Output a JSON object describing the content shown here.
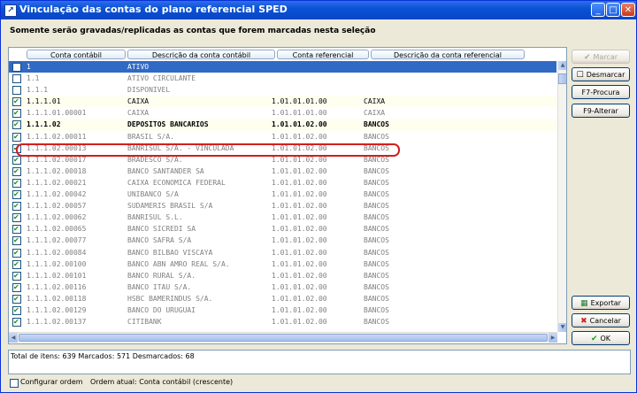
{
  "window": {
    "title": "Vinculação das contas do plano referencial SPED",
    "minimize": "_",
    "maximize": "□",
    "close": "✕"
  },
  "subtitle": "Somente serão gravadas/replicadas as contas que forem marcadas nesta seleção",
  "columns": [
    "Conta contábil",
    "Descrição da conta contábil",
    "Conta referencial",
    "Descrição da conta referencial"
  ],
  "rows": [
    {
      "checked": false,
      "style": "sel",
      "conta": "1",
      "descricao": "ATIVO",
      "ref": "",
      "ref_desc": ""
    },
    {
      "checked": false,
      "style": "",
      "conta": "1.1",
      "descricao": "ATIVO CIRCULANTE",
      "ref": "",
      "ref_desc": ""
    },
    {
      "checked": false,
      "style": "",
      "conta": "1.1.1",
      "descricao": "DISPONIVEL",
      "ref": "",
      "ref_desc": ""
    },
    {
      "checked": true,
      "style": "hl",
      "conta": "1.1.1.01",
      "descricao": "CAIXA",
      "ref": "1.01.01.01.00",
      "ref_desc": "CAIXA"
    },
    {
      "checked": true,
      "style": "",
      "conta": "1.1.1.01.00001",
      "descricao": "CAIXA",
      "ref": "1.01.01.01.00",
      "ref_desc": "CAIXA"
    },
    {
      "checked": true,
      "style": "syn",
      "conta": "1.1.1.02",
      "descricao": "DEPOSITOS BANCARIOS",
      "ref": "1.01.01.02.00",
      "ref_desc": "BANCOS"
    },
    {
      "checked": true,
      "style": "",
      "conta": "1.1.1.02.00011",
      "descricao": "BRASIL S/A.",
      "ref": "1.01.01.02.00",
      "ref_desc": "BANCOS"
    },
    {
      "checked": true,
      "style": "",
      "conta": "1.1.1.02.00013",
      "descricao": "BANRISUL S/A. - VINCULADA",
      "ref": "1.01.01.02.00",
      "ref_desc": "BANCOS"
    },
    {
      "checked": true,
      "style": "",
      "conta": "1.1.1.02.00017",
      "descricao": "BRADESCO S/A.",
      "ref": "1.01.01.02.00",
      "ref_desc": "BANCOS"
    },
    {
      "checked": true,
      "style": "",
      "conta": "1.1.1.02.00018",
      "descricao": "BANCO SANTANDER SA",
      "ref": "1.01.01.02.00",
      "ref_desc": "BANCOS"
    },
    {
      "checked": true,
      "style": "",
      "conta": "1.1.1.02.00021",
      "descricao": "CAIXA ECONOMICA FEDERAL",
      "ref": "1.01.01.02.00",
      "ref_desc": "BANCOS"
    },
    {
      "checked": true,
      "style": "",
      "conta": "1.1.1.02.00042",
      "descricao": "UNIBANCO S/A",
      "ref": "1.01.01.02.00",
      "ref_desc": "BANCOS"
    },
    {
      "checked": true,
      "style": "",
      "conta": "1.1.1.02.00057",
      "descricao": "SUDAMERIS BRASIL S/A",
      "ref": "1.01.01.02.00",
      "ref_desc": "BANCOS"
    },
    {
      "checked": true,
      "style": "",
      "conta": "1.1.1.02.00062",
      "descricao": "BANRISUL S.L.",
      "ref": "1.01.01.02.00",
      "ref_desc": "BANCOS"
    },
    {
      "checked": true,
      "style": "",
      "conta": "1.1.1.02.00065",
      "descricao": "BANCO SICREDI SA",
      "ref": "1.01.01.02.00",
      "ref_desc": "BANCOS"
    },
    {
      "checked": true,
      "style": "",
      "conta": "1.1.1.02.00077",
      "descricao": "BANCO SAFRA S/A",
      "ref": "1.01.01.02.00",
      "ref_desc": "BANCOS"
    },
    {
      "checked": true,
      "style": "",
      "conta": "1.1.1.02.00084",
      "descricao": "BANCO BILBAO VISCAYA",
      "ref": "1.01.01.02.00",
      "ref_desc": "BANCOS"
    },
    {
      "checked": true,
      "style": "",
      "conta": "1.1.1.02.00100",
      "descricao": "BANCO ABN AMRO REAL S/A.",
      "ref": "1.01.01.02.00",
      "ref_desc": "BANCOS"
    },
    {
      "checked": true,
      "style": "",
      "conta": "1.1.1.02.00101",
      "descricao": "BANCO RURAL S/A.",
      "ref": "1.01.01.02.00",
      "ref_desc": "BANCOS"
    },
    {
      "checked": true,
      "style": "",
      "conta": "1.1.1.02.00116",
      "descricao": "BANCO ITAU S/A.",
      "ref": "1.01.01.02.00",
      "ref_desc": "BANCOS"
    },
    {
      "checked": true,
      "style": "",
      "conta": "1.1.1.02.00118",
      "descricao": "HSBC BAMERINDUS S/A.",
      "ref": "1.01.01.02.00",
      "ref_desc": "BANCOS"
    },
    {
      "checked": true,
      "style": "",
      "conta": "1.1.1.02.00129",
      "descricao": "BANCO DO URUGUAI",
      "ref": "1.01.01.02.00",
      "ref_desc": "BANCOS"
    },
    {
      "checked": true,
      "style": "",
      "conta": "1.1.1.02.00137",
      "descricao": "CITIBANK",
      "ref": "1.01.01.02.00",
      "ref_desc": "BANCOS"
    }
  ],
  "buttons": {
    "marcar": "Marcar",
    "desmarcar": "Desmarcar",
    "procura": "F7-Procura",
    "alterar": "F9-Alterar",
    "exportar": "Exportar",
    "cancelar": "Cancelar",
    "ok": "OK"
  },
  "status": "Total de itens: 639 Marcados: 571 Desmarcados: 68",
  "footer": {
    "configurar_ordem": "Configurar ordem",
    "ordem_atual": "Ordem atual: Conta contábil (crescente)"
  },
  "icons": {
    "marcar": "check-icon",
    "desmarcar": "checkbox-empty-icon",
    "exportar": "export-icon",
    "cancelar": "cancel-x-icon",
    "ok": "ok-check-icon"
  },
  "colors": {
    "title_bar": "#0a52d6",
    "selection": "#316ac5",
    "highlight_ring": "#d21f1f"
  }
}
